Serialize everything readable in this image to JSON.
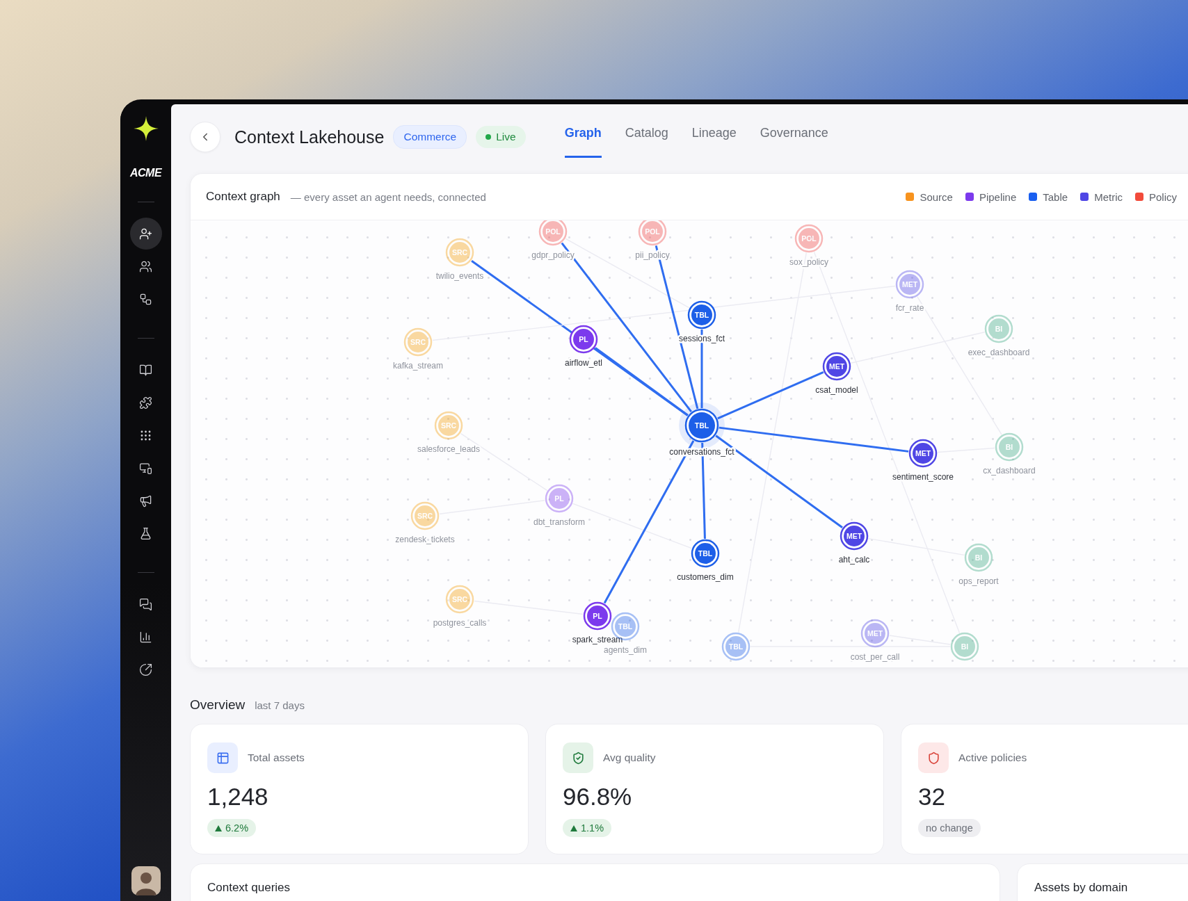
{
  "sidebar": {
    "brand": "ACME",
    "items": [
      {
        "selected": true
      },
      {
        "selected": false
      },
      {
        "selected": false
      },
      {
        "selected": false
      },
      {
        "selected": false
      },
      {
        "selected": false
      },
      {
        "selected": false
      },
      {
        "selected": false
      },
      {
        "selected": false
      },
      {
        "selected": false
      },
      {
        "selected": false
      },
      {
        "selected": false
      }
    ]
  },
  "header": {
    "title": "Context Lakehouse",
    "tag": "Commerce",
    "status": {
      "text": "Live",
      "live": true
    }
  },
  "tabs": [
    {
      "label": "Graph",
      "selected": true
    },
    {
      "label": "Catalog",
      "selected": false
    },
    {
      "label": "Lineage",
      "selected": false
    },
    {
      "label": "Governance",
      "selected": false
    }
  ],
  "graph": {
    "title": "Context graph",
    "subtitle": "— every asset an agent needs, connected",
    "legend": [
      {
        "label": "Source",
        "color": "#f7931e"
      },
      {
        "label": "Pipeline",
        "color": "#7c3aed"
      },
      {
        "label": "Table",
        "color": "#1a5ff0"
      },
      {
        "label": "Metric",
        "color": "#4f46e5"
      },
      {
        "label": "Policy",
        "color": "#f24b3b"
      }
    ],
    "nodes": [
      {
        "kind": "policy",
        "badge": "POL",
        "label": "gdpr_policy",
        "dimmed": true,
        "focused": false
      },
      {
        "kind": "policy",
        "badge": "POL",
        "label": "pii_policy",
        "dimmed": true,
        "focused": false
      },
      {
        "kind": "policy",
        "badge": "POL",
        "label": "sox_policy",
        "dimmed": true,
        "focused": false
      },
      {
        "kind": "source",
        "badge": "SRC",
        "label": "twilio_events",
        "dimmed": true,
        "focused": false
      },
      {
        "kind": "metric",
        "badge": "MET",
        "label": "fcr_rate",
        "dimmed": true,
        "focused": false
      },
      {
        "kind": "table",
        "badge": "TBL",
        "label": "sessions_fct",
        "dimmed": false,
        "focused": false
      },
      {
        "kind": "bi",
        "badge": "BI",
        "label": "exec_dashboard",
        "dimmed": true,
        "focused": false
      },
      {
        "kind": "source",
        "badge": "SRC",
        "label": "kafka_stream",
        "dimmed": true,
        "focused": false
      },
      {
        "kind": "pipeline",
        "badge": "PL",
        "label": "airflow_etl",
        "dimmed": false,
        "focused": false
      },
      {
        "kind": "metric",
        "badge": "MET",
        "label": "csat_model",
        "dimmed": false,
        "focused": false
      },
      {
        "kind": "source",
        "badge": "SRC",
        "label": "salesforce_leads",
        "dimmed": true,
        "focused": false
      },
      {
        "kind": "table",
        "badge": "TBL",
        "label": "conversations_fct",
        "dimmed": false,
        "focused": true
      },
      {
        "kind": "metric",
        "badge": "MET",
        "label": "sentiment_score",
        "dimmed": false,
        "focused": false
      },
      {
        "kind": "bi",
        "badge": "BI",
        "label": "cx_dashboard",
        "dimmed": true,
        "focused": false
      },
      {
        "kind": "pipeline",
        "badge": "PL",
        "label": "dbt_transform",
        "dimmed": true,
        "focused": false
      },
      {
        "kind": "source",
        "badge": "SRC",
        "label": "zendesk_tickets",
        "dimmed": true,
        "focused": false
      },
      {
        "kind": "table",
        "badge": "TBL",
        "label": "customers_dim",
        "dimmed": false,
        "focused": false
      },
      {
        "kind": "metric",
        "badge": "MET",
        "label": "aht_calc",
        "dimmed": false,
        "focused": false
      },
      {
        "kind": "bi",
        "badge": "BI",
        "label": "ops_report",
        "dimmed": true,
        "focused": false
      },
      {
        "kind": "source",
        "badge": "SRC",
        "label": "postgres_calls",
        "dimmed": true,
        "focused": false
      },
      {
        "kind": "pipeline",
        "badge": "PL",
        "label": "spark_stream",
        "dimmed": false,
        "focused": false
      },
      {
        "kind": "table",
        "badge": "TBL",
        "label": "agents_dim",
        "dimmed": true,
        "focused": false
      },
      {
        "kind": "table",
        "badge": "TBL",
        "dimmed": true,
        "focused": false
      },
      {
        "kind": "metric",
        "badge": "MET",
        "label": "cost_per_call",
        "dimmed": true,
        "focused": false
      },
      {
        "kind": "bi",
        "badge": "BI",
        "dimmed": true,
        "focused": false
      }
    ]
  },
  "overview": {
    "title": "Overview",
    "period": "last 7 days",
    "stats": [
      {
        "kind": "assets",
        "label": "Total assets",
        "value": "1,248",
        "delta": "6.2%",
        "rising": true
      },
      {
        "kind": "quality",
        "label": "Avg quality",
        "value": "96.8%",
        "delta": "1.1%",
        "rising": true
      },
      {
        "kind": "policies",
        "label": "Active policies",
        "value": "32",
        "delta": "no change",
        "rising": false
      }
    ]
  },
  "panels": [
    {
      "title": "Context queries"
    },
    {
      "title": "Assets by domain"
    }
  ]
}
